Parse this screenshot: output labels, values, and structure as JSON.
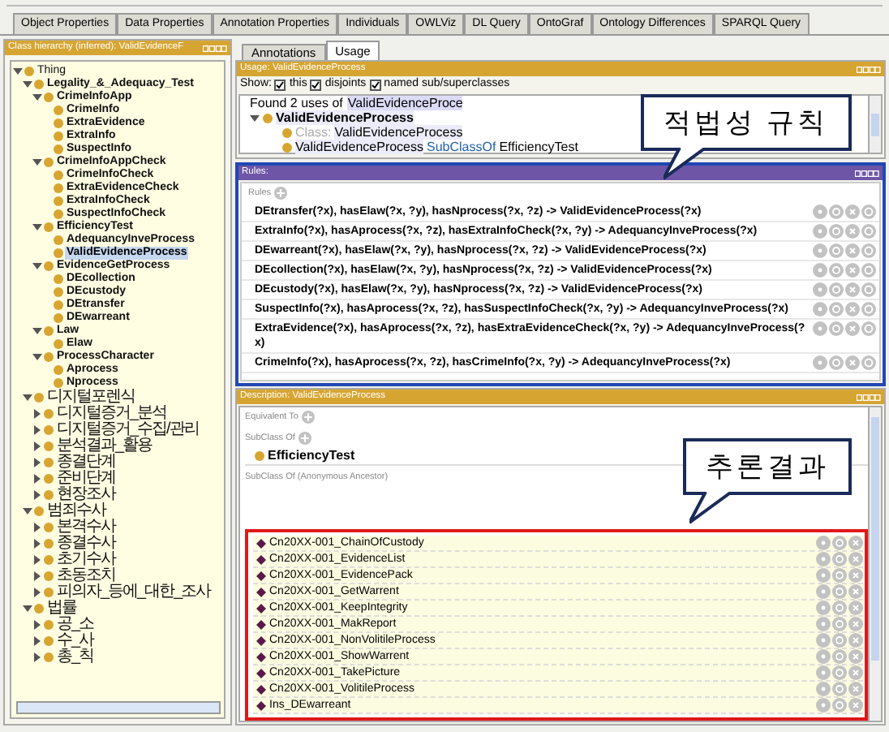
{
  "top_tabs": [
    {
      "label": "Object Properties",
      "selected": false
    },
    {
      "label": "Data Properties",
      "selected": false
    },
    {
      "label": "Annotation Properties",
      "selected": false
    },
    {
      "label": "Individuals",
      "selected": false
    },
    {
      "label": "OWLViz",
      "selected": false
    },
    {
      "label": "DL Query",
      "selected": false
    },
    {
      "label": "OntoGraf",
      "selected": false
    },
    {
      "label": "Ontology Differences",
      "selected": false
    },
    {
      "label": "SPARQL Query",
      "selected": false
    }
  ],
  "class_hierarchy": {
    "title": "Class hierarchy (inferred): ValidEvidenceF",
    "tree": [
      {
        "label": "Thing",
        "expanded": true,
        "selected": false,
        "children": [
          {
            "label": "Legality_&_Adequacy_Test",
            "expanded": true,
            "selected": false,
            "children": [
              {
                "label": "CrimeInfoApp",
                "expanded": true,
                "selected": false,
                "children": [
                  {
                    "label": "CrimeInfo",
                    "selected": false
                  },
                  {
                    "label": "ExtraEvidence",
                    "selected": false
                  },
                  {
                    "label": "ExtraInfo",
                    "selected": false
                  },
                  {
                    "label": "SuspectInfo",
                    "selected": false
                  }
                ]
              },
              {
                "label": "CrimeInfoAppCheck",
                "expanded": true,
                "selected": false,
                "children": [
                  {
                    "label": "CrimeInfoCheck",
                    "selected": false
                  },
                  {
                    "label": "ExtraEvidenceCheck",
                    "selected": false
                  },
                  {
                    "label": "ExtraInfoCheck",
                    "selected": false
                  },
                  {
                    "label": "SuspectInfoCheck",
                    "selected": false
                  }
                ]
              },
              {
                "label": "EfficiencyTest",
                "expanded": true,
                "selected": false,
                "children": [
                  {
                    "label": "AdequancyInveProcess",
                    "selected": false
                  },
                  {
                    "label": "ValidEvidenceProcess",
                    "selected": true
                  }
                ]
              },
              {
                "label": "EvidenceGetProcess",
                "expanded": true,
                "selected": false,
                "children": [
                  {
                    "label": "DEcollection",
                    "selected": false
                  },
                  {
                    "label": "DEcustody",
                    "selected": false
                  },
                  {
                    "label": "DEtransfer",
                    "selected": false
                  },
                  {
                    "label": "DEwarreant",
                    "selected": false
                  }
                ]
              },
              {
                "label": "Law",
                "expanded": true,
                "selected": false,
                "children": [
                  {
                    "label": "Elaw",
                    "selected": false
                  }
                ]
              },
              {
                "label": "ProcessCharacter",
                "expanded": true,
                "selected": false,
                "children": [
                  {
                    "label": "Aprocess",
                    "selected": false
                  },
                  {
                    "label": "Nprocess",
                    "selected": false
                  }
                ]
              }
            ]
          },
          {
            "label": "디지털포렌식",
            "expanded": true,
            "selected": false,
            "children": [
              {
                "label": "디지털증거_분석",
                "expanded": false,
                "selected": false
              },
              {
                "label": "디지털증거_수집/관리",
                "expanded": false,
                "selected": false
              },
              {
                "label": "분석결과_활용",
                "expanded": false,
                "selected": false
              },
              {
                "label": "종결단계",
                "expanded": false,
                "selected": false
              },
              {
                "label": "준비단계",
                "expanded": false,
                "selected": false
              },
              {
                "label": "현장조사",
                "expanded": false,
                "selected": false
              }
            ]
          },
          {
            "label": "범죄수사",
            "expanded": true,
            "selected": false,
            "children": [
              {
                "label": "본격수사",
                "expanded": false,
                "selected": false
              },
              {
                "label": "종결수사",
                "expanded": false,
                "selected": false
              },
              {
                "label": "초기수사",
                "expanded": false,
                "selected": false
              },
              {
                "label": "초동조치",
                "expanded": false,
                "selected": false
              },
              {
                "label": "피의자_등에_대한_조사",
                "expanded": false,
                "selected": false
              }
            ]
          },
          {
            "label": "법률",
            "expanded": true,
            "selected": false,
            "children": [
              {
                "label": "공_소",
                "expanded": false,
                "selected": false
              },
              {
                "label": "수_사",
                "expanded": false,
                "selected": false
              },
              {
                "label": "총_칙",
                "expanded": false,
                "selected": false
              }
            ]
          }
        ]
      }
    ]
  },
  "usage_tabs": [
    {
      "label": "Annotations",
      "selected": false
    },
    {
      "label": "Usage",
      "selected": true
    }
  ],
  "usage": {
    "title": "Usage: ValidEvidenceProcess",
    "show_label": "Show:",
    "filters": [
      {
        "label": "this",
        "checked": true
      },
      {
        "label": "disjoints",
        "checked": true
      },
      {
        "label": "named sub/superclasses",
        "checked": true
      }
    ],
    "found_prefix": "Found 2 uses of",
    "found_name": "ValidEvidenceProce",
    "result": {
      "label": "ValidEvidenceProcess",
      "expanded": true,
      "uses": [
        {
          "kind": "declaration",
          "keyword": "Class:",
          "subject": "ValidEvidenceProcess"
        },
        {
          "kind": "axiom",
          "subject": "ValidEvidenceProcess",
          "keyword": "SubClassOf",
          "object": "EfficiencyTest"
        }
      ]
    }
  },
  "rules": {
    "title": "Rules:",
    "label": "Rules",
    "items": [
      "DEtransfer(?x), hasElaw(?x, ?y), hasNprocess(?x, ?z) -> ValidEvidenceProcess(?x)",
      "ExtraInfo(?x), hasAprocess(?x, ?z), hasExtraInfoCheck(?x, ?y) -> AdequancyInveProcess(?x)",
      "DEwarreant(?x), hasElaw(?x, ?y), hasNprocess(?x, ?z) -> ValidEvidenceProcess(?x)",
      "DEcollection(?x), hasElaw(?x, ?y), hasNprocess(?x, ?z) -> ValidEvidenceProcess(?x)",
      "DEcustody(?x), hasElaw(?x, ?y), hasNprocess(?x, ?z) -> ValidEvidenceProcess(?x)",
      "SuspectInfo(?x), hasAprocess(?x, ?z), hasSuspectInfoCheck(?x, ?y) -> AdequancyInveProcess(?x)",
      "ExtraEvidence(?x), hasAprocess(?x, ?z), hasExtraEvidenceCheck(?x, ?y) -> AdequancyInveProcess(?x)",
      "CrimeInfo(?x), hasAprocess(?x, ?z), hasCrimeInfo(?x, ?y) -> AdequancyInveProcess(?x)"
    ]
  },
  "description": {
    "title": "Description: ValidEvidenceProcess",
    "sections": [
      {
        "label": "Equivalent To"
      },
      {
        "label": "SubClass Of",
        "items": [
          "EfficiencyTest"
        ]
      },
      {
        "label": "SubClass Of (Anonymous Ancestor)"
      }
    ],
    "members": [
      "Cn20XX-001_ChainOfCustody",
      "Cn20XX-001_EvidenceList",
      "Cn20XX-001_EvidencePack",
      "Cn20XX-001_GetWarrent",
      "Cn20XX-001_KeepIntegrity",
      "Cn20XX-001_MakReport",
      "Cn20XX-001_NonVolitileProcess",
      "Cn20XX-001_ShowWarrent",
      "Cn20XX-001_TakePicture",
      "Cn20XX-001_VolitileProcess",
      "Ins_DEwarreant"
    ]
  },
  "callouts": [
    {
      "text": "적법성 규칙"
    },
    {
      "text": "추론결과"
    }
  ]
}
